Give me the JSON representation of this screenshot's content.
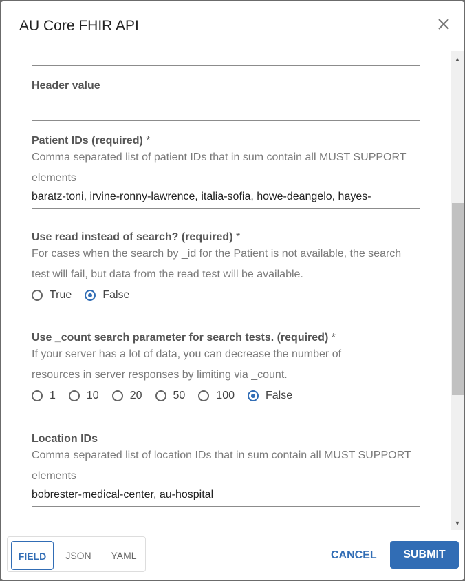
{
  "dialog": {
    "title": "AU Core FHIR API",
    "close_icon": "close-icon"
  },
  "fields": {
    "header_value": {
      "label": "Header value",
      "value": ""
    },
    "patient_ids": {
      "label": "Patient IDs (required)",
      "required_mark": "*",
      "description": "Comma separated list of patient IDs that in sum contain all MUST SUPPORT elements",
      "value": "baratz-toni, irvine-ronny-lawrence, italia-sofia, howe-deangelo, hayes-"
    },
    "use_read": {
      "label": "Use read instead of search? (required)",
      "required_mark": "*",
      "description": "For cases when the search by _id for the Patient is not available, the search test will fail, but data from the read test will be available.",
      "options": [
        {
          "label": "True",
          "selected": false
        },
        {
          "label": "False",
          "selected": true
        }
      ]
    },
    "use_count": {
      "label": "Use _count search parameter for search tests. (required)",
      "required_mark": "*",
      "description": "If your server has a lot of data, you can decrease the number of resources in server responses by limiting via _count.",
      "options": [
        {
          "label": "1",
          "selected": false
        },
        {
          "label": "10",
          "selected": false
        },
        {
          "label": "20",
          "selected": false
        },
        {
          "label": "50",
          "selected": false
        },
        {
          "label": "100",
          "selected": false
        },
        {
          "label": "False",
          "selected": true
        }
      ]
    },
    "location_ids": {
      "label": "Location IDs",
      "description": "Comma separated list of location IDs that in sum contain all MUST SUPPORT elements",
      "value": "bobrester-medical-center, au-hospital"
    }
  },
  "footer": {
    "tabs": [
      "FIELD",
      "JSON",
      "YAML"
    ],
    "active_tab": "FIELD",
    "cancel_label": "CANCEL",
    "submit_label": "SUBMIT"
  },
  "colors": {
    "accent": "#316db5"
  }
}
